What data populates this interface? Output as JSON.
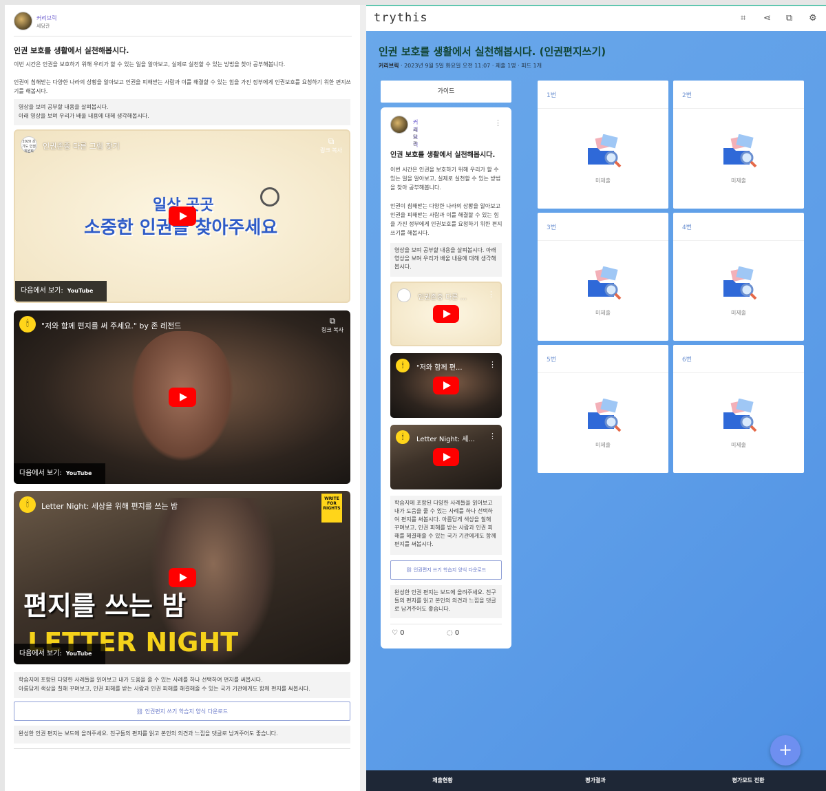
{
  "left": {
    "author": "커리브릭",
    "author_sub": "세담관",
    "title": "인권 보호를 생활에서 실천해봅시다.",
    "para1": "이번 시간은 인권을 보호하기 위해 우리가 할 수 있는 일을 알아보고, 실제로 실천할 수 있는 방법을 찾아 공부해봅니다.",
    "para2": "인권이 침해받는 다양한 나라의 상황을 알아보고 인권을 피해받는 사람과 이를 해결할 수 있는 힘을 가진 정부에게 인권보호를 요청하기 위한 편지쓰기를 해봅시다.",
    "box1_line1": "영상을 보며 공부할 내용을 살펴봅시다.",
    "box1_line2": "아래 영상을 보며 우리가 배울 내용에 대해 생각해봅시다.",
    "videos": [
      {
        "title": "인권존중 다른 그림 찾기",
        "logo": "2020 초기도 인권위원회",
        "banner1": "일상 곳곳",
        "banner2": "소중한 인권을 찾아주세요"
      },
      {
        "title": "\"저와 함께 편지를 써 주세요.\" by 존 레전드"
      },
      {
        "title": "Letter Night: 세상을 위해 편지를 쓰는 밤",
        "banner1": "편지를 쓰는 밤",
        "banner2": "LETTER NIGHT",
        "badge": "WRITE FOR RIGHTS"
      }
    ],
    "watch_on": "다음에서 보기:",
    "youtube": "YouTube",
    "copy_link": "링크 복사",
    "box2_line1": "학습지에 포함된 다양한 사례들을 읽어보고 내가 도움을 줄 수 있는 사례를 하나 선택하여 편지를 써봅시다.",
    "box2_line2": "아름답게 색상을 칠해 꾸며보고, 인권 피해를 받는 사람과 인권 피해를 해결해줄 수 있는 국가 기관에게도 함께 편지를 써봅시다.",
    "download": "인권편지 쓰기 학습지 양식 다운로드",
    "box3": "완성한 인권 편지는 보드에 올려주세요. 친구들의 편지를 읽고 본인의 의견과 느낌을 댓글로 남겨주어도 좋습니다."
  },
  "right": {
    "brand": "trythis",
    "title": "인권 보호를 생활에서 실천해봅시다. (인권편지쓰기)",
    "meta_author": "커리브릭",
    "meta_rest": "· 2023년 9월 5일 화요일 오전 11:07 · 제출 1명 · 피드 1개",
    "guide_button": "가이드",
    "guide": {
      "author": "커리브릭",
      "author_sub": "세담관",
      "title": "인권 보호를 생활에서 실천해봅시다.",
      "para1": "이번 시간은 인권을 보호하기 위해 우리가 할 수 있는 일을 알아보고, 실제로 실천할 수 있는 방법을 찾아 공부해봅니다.",
      "para2": "인권이 침해받는 다양한 나라의 상황을 알아보고 인권을 피해받는 사람과 이를 해결할 수 있는 힘을 가진 정부에게 인권보호를 요청하기 위한 편지쓰기를 해봅시다.",
      "box1": "영상을 보며 공부할 내용을 살펴봅시다. 아래 영상을 보며 우리가 배울 내용에 대해 생각해봅시다.",
      "mini_titles": [
        "인권존중 다른 ...",
        "\"저와 함께 편...",
        "Letter Night: 세..."
      ],
      "box2": "학습지에 포함된 다양한 사례들을 읽어보고 내가 도움을 줄 수 있는 사례를 하나 선택하여 편지를 써봅시다. 아름답게 색상을 칠해 꾸며보고, 인권 피해를 받는 사람과 인권 피해를 해결해줄 수 있는 국가 기관에게도 함께 편지를 써봅시다.",
      "download": "인권편지 쓰기 학습지 양식 다운로드",
      "box3": "완성한 인권 편지는 보드에 올려주세요. 친구들의 편지를 읽고 본인의 의견과 느낌을 댓글로 남겨주어도 좋습니다.",
      "likes": "0",
      "comments": "0"
    },
    "cells": [
      {
        "label": "1번",
        "status": "미제출"
      },
      {
        "label": "2번",
        "status": "미제출"
      },
      {
        "label": "3번",
        "status": "미제출"
      },
      {
        "label": "4번",
        "status": "미제출"
      },
      {
        "label": "5번",
        "status": "미제출"
      },
      {
        "label": "6번",
        "status": "미제출"
      }
    ],
    "fab": "+",
    "bottom_tabs": [
      "제출현황",
      "평가결과",
      "평가모드 전환"
    ]
  }
}
